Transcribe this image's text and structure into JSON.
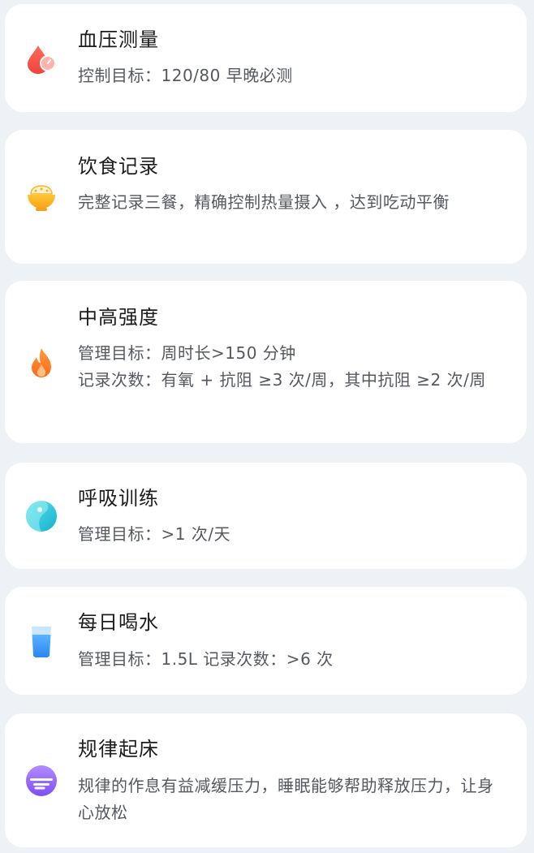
{
  "cards": [
    {
      "icon": "blood-drop-gauge-icon",
      "title": "血压测量",
      "lines": [
        "控制目标：120/80  早晚必测"
      ]
    },
    {
      "icon": "rice-bowl-icon",
      "title": "饮食记录",
      "lines": [
        "完整记录三餐，精确控制热量摄入 ，达到吃动平衡"
      ]
    },
    {
      "icon": "flame-icon",
      "title": "中高强度",
      "lines": [
        "管理目标：周时长>150 分钟",
        "记录次数：有氧 + 抗阻 ≥3 次/周，其中抗阻 ≥2 次/周"
      ]
    },
    {
      "icon": "breath-circle-icon",
      "title": "呼吸训练",
      "lines": [
        "管理目标：>1 次/天"
      ]
    },
    {
      "icon": "water-glass-icon",
      "title": "每日喝水",
      "lines": [
        "管理目标：1.5L  记录次数：>6 次"
      ]
    },
    {
      "icon": "sunrise-icon",
      "title": "规律起床",
      "lines": [
        "规律的作息有益减缓压力，睡眠能够帮助释放压力，让身心放松"
      ]
    }
  ]
}
